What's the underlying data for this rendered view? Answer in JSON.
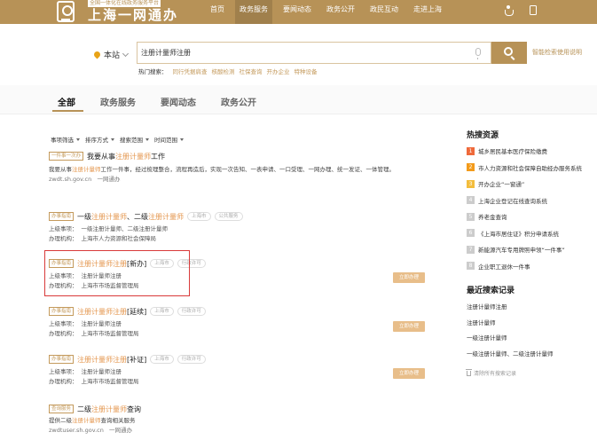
{
  "header": {
    "logo_subtitle": "全国一体化在线政务服务平台",
    "logo_title": "上海一网通办",
    "nav": [
      {
        "label": "首页",
        "active": false
      },
      {
        "label": "政务服务",
        "active": true
      },
      {
        "label": "要闻动态",
        "active": false
      },
      {
        "label": "政务公开",
        "active": false
      },
      {
        "label": "政民互动",
        "active": false
      },
      {
        "label": "走进上海",
        "active": false
      }
    ],
    "icons": [
      "accessibility-icon",
      "mobile-icon"
    ]
  },
  "search": {
    "scope": "本站",
    "value": "注册计量师注册",
    "help": "智能检索使用说明",
    "hot_label": "热门搜索：",
    "hot_links": [
      "同行凭据肩查",
      "核酸检测",
      "社保查询",
      "开办企业",
      "特种设备"
    ]
  },
  "tabs": [
    {
      "label": "全部",
      "active": true
    },
    {
      "label": "政务服务",
      "active": false
    },
    {
      "label": "要闻动态",
      "active": false
    },
    {
      "label": "政务公开",
      "active": false
    }
  ],
  "filters": [
    "事项筛选",
    "排序方式",
    "搜索范围",
    "时间范围"
  ],
  "results": [
    {
      "tag": "一件事一次办",
      "title_pre": "我要从事",
      "title_hl": "注册计量师",
      "title_post": "工作",
      "desc_pre": "我要从事",
      "desc_hl": "注册计量师",
      "desc_post": "工作一件事，经过梳理整合，流程再造后，实现一次告知、一表申请、一口受理、一网办理、统一发证、一体管理。",
      "source": "zwdt.sh.gov.cn",
      "source_name": "一网通办"
    },
    {
      "tag": "办事指南",
      "title_a": "一级",
      "title_hl1": "注册计量师",
      "title_b": "、二级",
      "title_hl2": "注册计量师",
      "pills": [
        "上海市",
        "公共服务"
      ],
      "parent_label": "上级事项：",
      "parent_value": "一级注册计量师、二级注册计量师",
      "org_label": "办理机构：",
      "org_value": "上海市人力资源和社会保障局"
    },
    {
      "tag": "办事指南",
      "title_hl": "注册计量师注册",
      "title_post": "[新办]",
      "pills": [
        "上海市",
        "行政许可"
      ],
      "parent_label": "上级事项：",
      "parent_value": "注册计量师注册",
      "org_label": "办理机构：",
      "org_value": "上海市市场监督管理局",
      "button": "立即办理"
    },
    {
      "tag": "办事指南",
      "title_hl": "注册计量师注册",
      "title_post": "[延续]",
      "pills": [
        "上海市",
        "行政许可"
      ],
      "parent_label": "上级事项：",
      "parent_value": "注册计量师注册",
      "org_label": "办理机构：",
      "org_value": "上海市市场监督管理局",
      "button": "立即办理"
    },
    {
      "tag": "办事指南",
      "title_hl": "注册计量师注册",
      "title_post": "[补证]",
      "pills": [
        "上海市",
        "行政许可"
      ],
      "parent_label": "上级事项：",
      "parent_value": "注册计量师注册",
      "org_label": "办理机构：",
      "org_value": "上海市市场监督管理局",
      "button": "立即办理"
    },
    {
      "tag": "查询服务",
      "title_pre": "二级",
      "title_hl": "注册计量师",
      "title_post": "查询",
      "desc_pre": "提供二级",
      "desc_hl": "注册计量师",
      "desc_post": "查询相关服务",
      "source": "zwdtuser.sh.gov.cn",
      "source_name": "一网通办"
    }
  ],
  "sidebar": {
    "hot_title": "热搜资源",
    "hot_items": [
      {
        "rank": "1",
        "label": "城乡居民基本医疗保险缴费"
      },
      {
        "rank": "2",
        "label": "市人力资源和社会保障自助经办服务系统"
      },
      {
        "rank": "3",
        "label": "开办企业“一窗通”"
      },
      {
        "rank": "4",
        "label": "上海企业登记在线查询系统"
      },
      {
        "rank": "5",
        "label": "养老金查询"
      },
      {
        "rank": "6",
        "label": "《上海市居住证》积分申请系统"
      },
      {
        "rank": "7",
        "label": "新能源汽车专用牌照申领“一件事”"
      },
      {
        "rank": "8",
        "label": "企业职工退休一件事"
      }
    ],
    "recent_title": "最近搜索记录",
    "recent_items": [
      "注册计量师注册",
      "注册计量师",
      "一级注册计量师",
      "一级注册计量师、二级注册计量师"
    ],
    "clear_label": "清除所有搜索记录"
  }
}
